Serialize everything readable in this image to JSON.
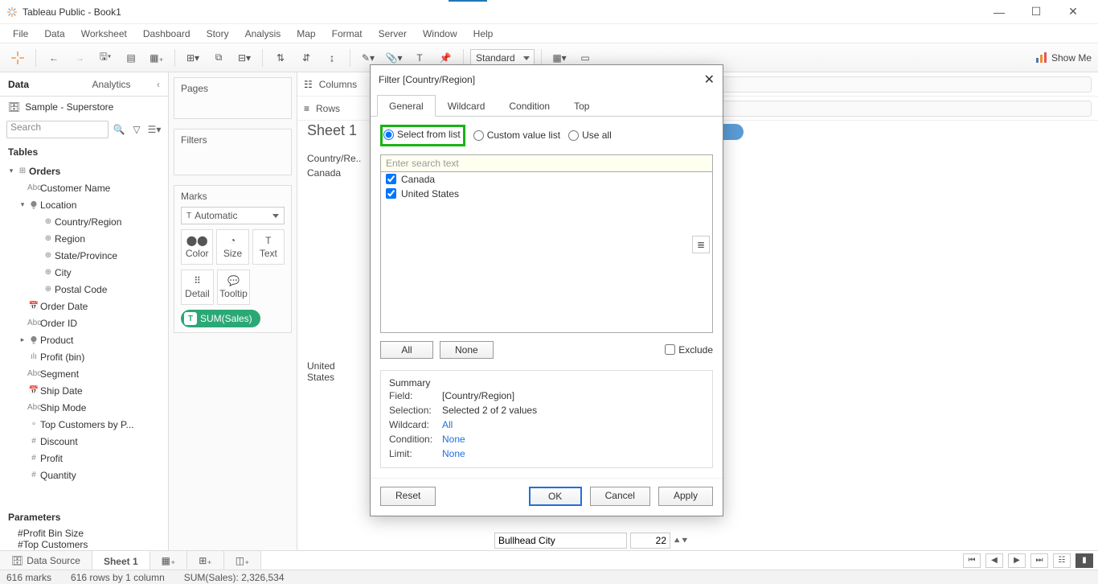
{
  "titlebar": {
    "title": "Tableau Public - Book1"
  },
  "menubar": [
    "File",
    "Data",
    "Worksheet",
    "Dashboard",
    "Story",
    "Analysis",
    "Map",
    "Format",
    "Server",
    "Window",
    "Help"
  ],
  "toolbar": {
    "fit": "Standard",
    "showme": "Show Me"
  },
  "sidebar": {
    "tabs": {
      "data": "Data",
      "analytics": "Analytics"
    },
    "datasource": "Sample - Superstore",
    "search_placeholder": "Search",
    "tables_label": "Tables",
    "params_label": "Parameters",
    "tree": [
      {
        "lvl": 0,
        "caret": "▾",
        "ico": "⊞",
        "t": "Orders",
        "bold": true
      },
      {
        "lvl": 1,
        "caret": "",
        "ico": "Abc",
        "t": "Customer Name"
      },
      {
        "lvl": 1,
        "caret": "▾",
        "ico": "⧭",
        "t": "Location"
      },
      {
        "lvl": 2,
        "caret": "",
        "ico": "⊕",
        "t": "Country/Region"
      },
      {
        "lvl": 2,
        "caret": "",
        "ico": "⊕",
        "t": "Region"
      },
      {
        "lvl": 2,
        "caret": "",
        "ico": "⊕",
        "t": "State/Province"
      },
      {
        "lvl": 2,
        "caret": "",
        "ico": "⊕",
        "t": "City"
      },
      {
        "lvl": 2,
        "caret": "",
        "ico": "⊕",
        "t": "Postal Code"
      },
      {
        "lvl": 1,
        "caret": "",
        "ico": "📅",
        "t": "Order Date"
      },
      {
        "lvl": 1,
        "caret": "",
        "ico": "Abc",
        "t": "Order ID"
      },
      {
        "lvl": 1,
        "caret": "▸",
        "ico": "⧭",
        "t": "Product"
      },
      {
        "lvl": 1,
        "caret": "",
        "ico": "ılı",
        "t": "Profit (bin)"
      },
      {
        "lvl": 1,
        "caret": "",
        "ico": "Abc",
        "t": "Segment"
      },
      {
        "lvl": 1,
        "caret": "",
        "ico": "📅",
        "t": "Ship Date"
      },
      {
        "lvl": 1,
        "caret": "",
        "ico": "Abc",
        "t": "Ship Mode"
      },
      {
        "lvl": 1,
        "caret": "",
        "ico": "∘",
        "t": "Top Customers by P..."
      },
      {
        "lvl": 1,
        "caret": "",
        "ico": "#",
        "t": "Discount"
      },
      {
        "lvl": 1,
        "caret": "",
        "ico": "#",
        "t": "Profit"
      },
      {
        "lvl": 1,
        "caret": "",
        "ico": "#",
        "t": "Quantity"
      }
    ],
    "params": [
      {
        "ico": "#",
        "t": "Profit Bin Size"
      },
      {
        "ico": "#",
        "t": "Top Customers"
      }
    ]
  },
  "mid": {
    "pages": "Pages",
    "filters": "Filters",
    "marks": "Marks",
    "mark_type": "Automatic",
    "cells": [
      "Color",
      "Size",
      "Text",
      "Detail",
      "Tooltip"
    ],
    "pill": "SUM(Sales)"
  },
  "canvas": {
    "columns": "Columns",
    "rows": "Rows",
    "sheet_title": "Sheet 1",
    "header_field": "Country/Re..",
    "r1": "Canada",
    "r2_a": "United",
    "r2_b": "States",
    "float_city": "Bullhead City",
    "float_num": "22"
  },
  "dialog": {
    "title": "Filter [Country/Region]",
    "tabs": [
      "General",
      "Wildcard",
      "Condition",
      "Top"
    ],
    "radios": {
      "select": "Select from list",
      "custom": "Custom value list",
      "useall": "Use all"
    },
    "search_placeholder": "Enter search text",
    "items": [
      "Canada",
      "United States"
    ],
    "btn_all": "All",
    "btn_none": "None",
    "exclude": "Exclude",
    "summary_label": "Summary",
    "summary": {
      "field_k": "Field:",
      "field_v": "[Country/Region]",
      "sel_k": "Selection:",
      "sel_v": "Selected 2 of 2 values",
      "wc_k": "Wildcard:",
      "wc_v": "All",
      "cond_k": "Condition:",
      "cond_v": "None",
      "lim_k": "Limit:",
      "lim_v": "None"
    },
    "reset": "Reset",
    "ok": "OK",
    "cancel": "Cancel",
    "apply": "Apply"
  },
  "bottom": {
    "datasource": "Data Source",
    "sheet": "Sheet 1"
  },
  "status": {
    "marks": "616 marks",
    "rows": "616 rows by 1 column",
    "sum": "SUM(Sales): 2,326,534"
  }
}
